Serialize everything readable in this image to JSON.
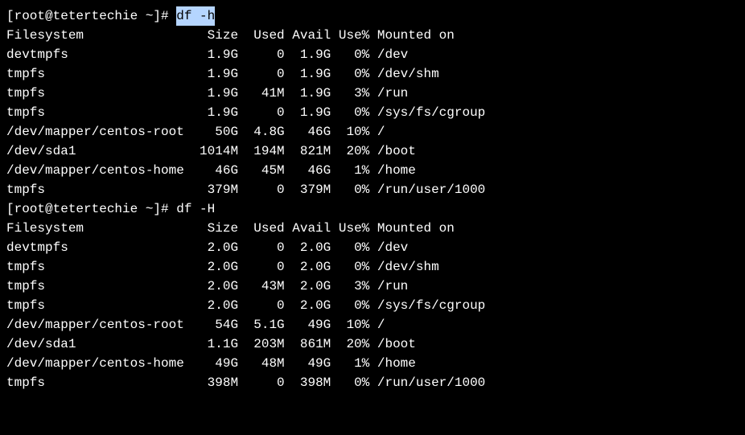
{
  "prompts": [
    {
      "prefix": "[root@tetertechie ~]# ",
      "cmd": "df -h",
      "highlighted": true
    },
    {
      "prefix": "[root@tetertechie ~]# ",
      "cmd": "df -H",
      "highlighted": false
    }
  ],
  "headers": {
    "fs": "Filesystem",
    "size": "Size",
    "used": "Used",
    "avail": "Avail",
    "usep": "Use%",
    "mnt": "Mounted on"
  },
  "blocks": [
    {
      "rows": [
        {
          "fs": "devtmpfs",
          "size": "1.9G",
          "used": "0",
          "avail": "1.9G",
          "usep": "0%",
          "mnt": "/dev"
        },
        {
          "fs": "tmpfs",
          "size": "1.9G",
          "used": "0",
          "avail": "1.9G",
          "usep": "0%",
          "mnt": "/dev/shm"
        },
        {
          "fs": "tmpfs",
          "size": "1.9G",
          "used": "41M",
          "avail": "1.9G",
          "usep": "3%",
          "mnt": "/run"
        },
        {
          "fs": "tmpfs",
          "size": "1.9G",
          "used": "0",
          "avail": "1.9G",
          "usep": "0%",
          "mnt": "/sys/fs/cgroup"
        },
        {
          "fs": "/dev/mapper/centos-root",
          "size": "50G",
          "used": "4.8G",
          "avail": "46G",
          "usep": "10%",
          "mnt": "/"
        },
        {
          "fs": "/dev/sda1",
          "size": "1014M",
          "used": "194M",
          "avail": "821M",
          "usep": "20%",
          "mnt": "/boot"
        },
        {
          "fs": "/dev/mapper/centos-home",
          "size": "46G",
          "used": "45M",
          "avail": "46G",
          "usep": "1%",
          "mnt": "/home"
        },
        {
          "fs": "tmpfs",
          "size": "379M",
          "used": "0",
          "avail": "379M",
          "usep": "0%",
          "mnt": "/run/user/1000"
        }
      ]
    },
    {
      "rows": [
        {
          "fs": "devtmpfs",
          "size": "2.0G",
          "used": "0",
          "avail": "2.0G",
          "usep": "0%",
          "mnt": "/dev"
        },
        {
          "fs": "tmpfs",
          "size": "2.0G",
          "used": "0",
          "avail": "2.0G",
          "usep": "0%",
          "mnt": "/dev/shm"
        },
        {
          "fs": "tmpfs",
          "size": "2.0G",
          "used": "43M",
          "avail": "2.0G",
          "usep": "3%",
          "mnt": "/run"
        },
        {
          "fs": "tmpfs",
          "size": "2.0G",
          "used": "0",
          "avail": "2.0G",
          "usep": "0%",
          "mnt": "/sys/fs/cgroup"
        },
        {
          "fs": "/dev/mapper/centos-root",
          "size": "54G",
          "used": "5.1G",
          "avail": "49G",
          "usep": "10%",
          "mnt": "/"
        },
        {
          "fs": "/dev/sda1",
          "size": "1.1G",
          "used": "203M",
          "avail": "861M",
          "usep": "20%",
          "mnt": "/boot"
        },
        {
          "fs": "/dev/mapper/centos-home",
          "size": "49G",
          "used": "48M",
          "avail": "49G",
          "usep": "1%",
          "mnt": "/home"
        },
        {
          "fs": "tmpfs",
          "size": "398M",
          "used": "0",
          "avail": "398M",
          "usep": "0%",
          "mnt": "/run/user/1000"
        }
      ]
    }
  ]
}
